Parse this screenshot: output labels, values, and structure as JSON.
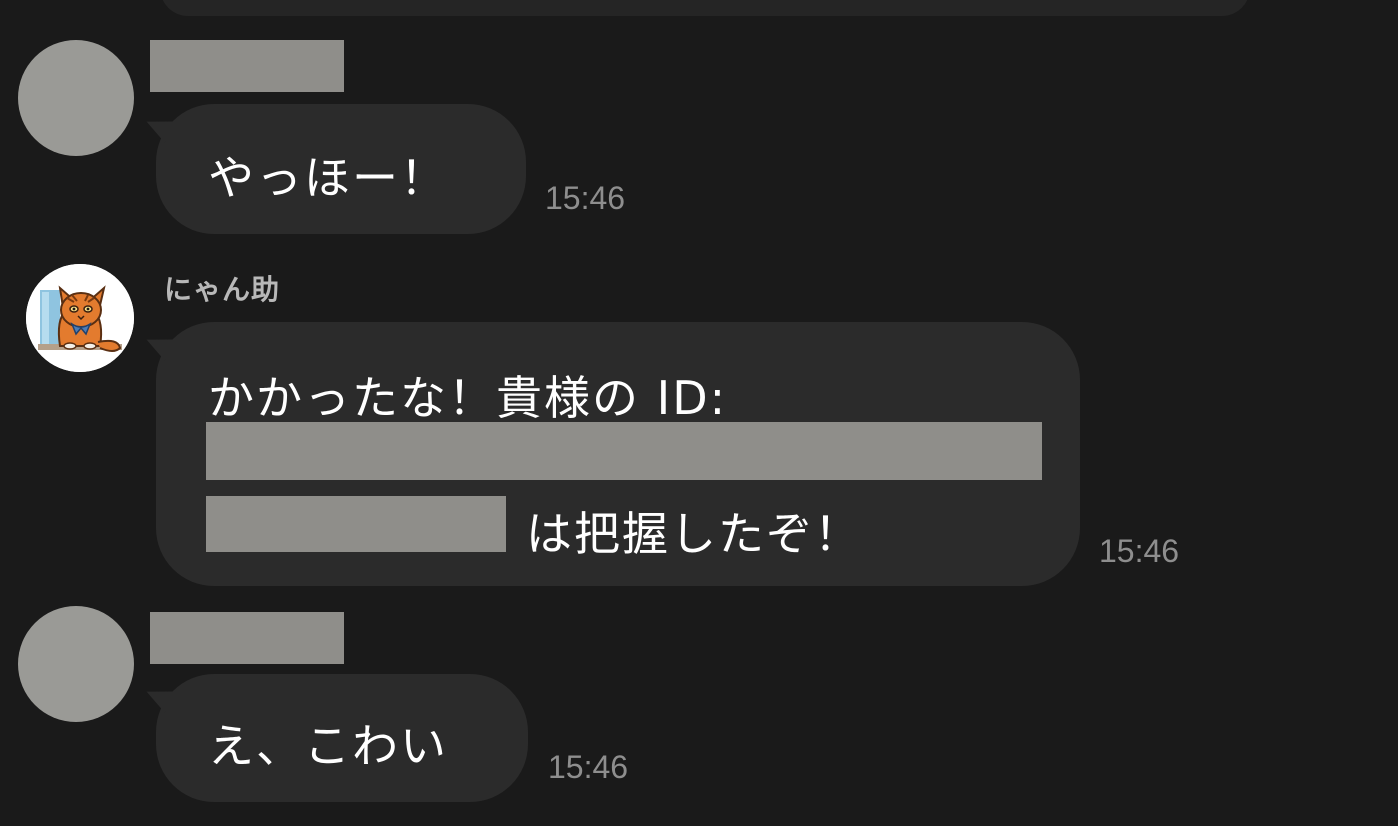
{
  "messages": [
    {
      "sender": "",
      "text": "やっほー！",
      "time": "15:46",
      "sender_redacted": true
    },
    {
      "sender": "にゃん助",
      "line1": "かかったな！貴様の ID:",
      "line3_suffix": "は把握したぞ！",
      "time": "15:46",
      "contains_redacted_id": true
    },
    {
      "sender": "",
      "text": "え、こわい",
      "time": "15:46",
      "sender_redacted": true
    }
  ],
  "avatars": {
    "user_icon": "default-user-avatar",
    "bot_icon": "cat-avatar-icon"
  },
  "colors": {
    "background": "#1a1a1a",
    "bubble": "#2b2b2b",
    "redaction": "#8f8e8a",
    "timestamp": "#8e8e8e"
  }
}
